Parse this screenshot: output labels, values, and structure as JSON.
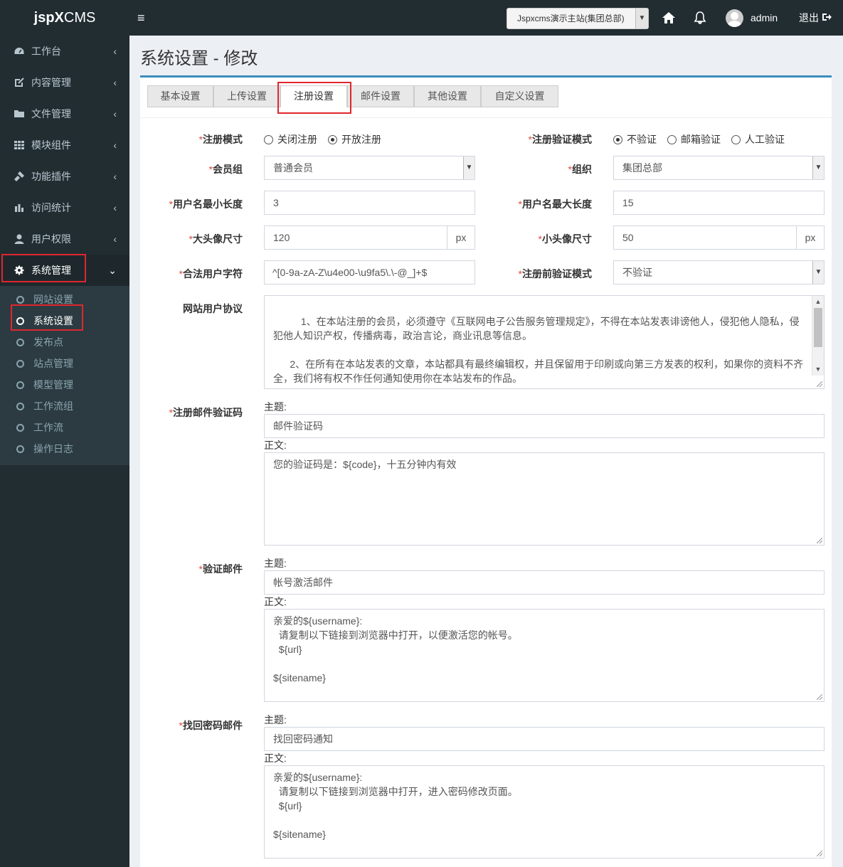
{
  "header": {
    "logo_prefix": "jspX",
    "logo_suffix": "CMS",
    "toggle": "≡",
    "site_select": "Jspxcms演示主站(集团总部)",
    "username": "admin",
    "logout": "退出"
  },
  "sidebar": {
    "items": [
      {
        "label": "工作台",
        "icon": "dashboard-icon"
      },
      {
        "label": "内容管理",
        "icon": "edit-icon"
      },
      {
        "label": "文件管理",
        "icon": "folder-icon"
      },
      {
        "label": "模块组件",
        "icon": "grid-icon"
      },
      {
        "label": "功能插件",
        "icon": "plug-icon"
      },
      {
        "label": "访问统计",
        "icon": "bar-chart-icon"
      },
      {
        "label": "用户权限",
        "icon": "user-icon"
      },
      {
        "label": "系统管理",
        "icon": "gear-icon"
      }
    ],
    "submenu": [
      "网站设置",
      "系统设置",
      "发布点",
      "站点管理",
      "模型管理",
      "工作流组",
      "工作流",
      "操作日志"
    ]
  },
  "page": {
    "title": "系统设置 - 修改"
  },
  "tabs": [
    "基本设置",
    "上传设置",
    "注册设置",
    "邮件设置",
    "其他设置",
    "自定义设置"
  ],
  "form": {
    "req_mark": "*",
    "reg_mode": {
      "label": "注册模式",
      "options": [
        "关闭注册",
        "开放注册"
      ],
      "selected": "开放注册"
    },
    "reg_verify_mode": {
      "label": "注册验证模式",
      "options": [
        "不验证",
        "邮箱验证",
        "人工验证"
      ],
      "selected": "不验证"
    },
    "member_group": {
      "label": "会员组",
      "value": "普通会员"
    },
    "org": {
      "label": "组织",
      "value": "集团总部"
    },
    "username_min": {
      "label": "用户名最小长度",
      "value": "3"
    },
    "username_max": {
      "label": "用户名最大长度",
      "value": "15"
    },
    "large_avatar": {
      "label": "大头像尺寸",
      "value": "120",
      "unit": "px"
    },
    "small_avatar": {
      "label": "小头像尺寸",
      "value": "50",
      "unit": "px"
    },
    "valid_chars": {
      "label": "合法用户字符",
      "value": "^[0-9a-zA-Z\\u4e00-\\u9fa5\\.\\-@_]+$"
    },
    "pre_reg_verify": {
      "label": "注册前验证模式",
      "value": "不验证"
    },
    "agreement": {
      "label": "网站用户协议",
      "value": "      1、在本站注册的会员，必须遵守《互联网电子公告服务管理规定》，不得在本站发表诽谤他人，侵犯他人隐私，侵犯他人知识产权，传播病毒，政治言论，商业讯息等信息。\n\n      2、在所有在本站发表的文章，本站都具有最终编辑权，并且保留用于印刷或向第三方发表的权利，如果你的资料不齐全，我们将有权不作任何通知使用你在本站发布的作品。"
    },
    "subject_label": "主题:",
    "body_label": "正文:",
    "reg_email_code": {
      "label": "注册邮件验证码",
      "subject": "邮件验证码",
      "body": "您的验证码是：${code}，十五分钟内有效"
    },
    "verify_email": {
      "label": "验证邮件",
      "subject": "帐号激活邮件",
      "body": "亲爱的${username}:\n  请复制以下链接到浏览器中打开，以便激活您的帐号。\n  ${url}\n\n${sitename}"
    },
    "reset_email": {
      "label": "找回密码邮件",
      "subject": "找回密码通知",
      "body": "亲爱的${username}:\n  请复制以下链接到浏览器中打开，进入密码修改页面。\n  ${url}\n\n${sitename}"
    }
  },
  "colors": {
    "sidebar": "#222d32",
    "accent": "#3c8dbc",
    "highlight": "#e0262e",
    "required": "#dd4b39"
  }
}
